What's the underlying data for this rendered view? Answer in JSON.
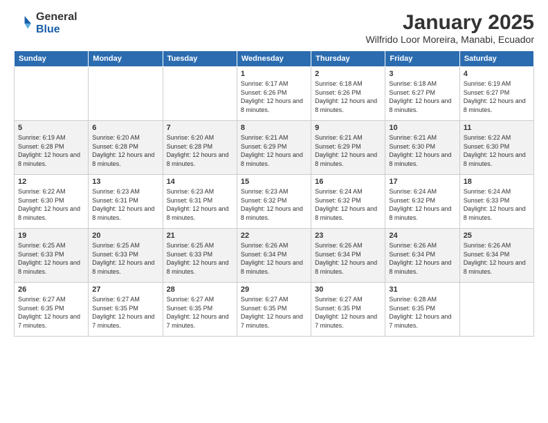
{
  "logo": {
    "general": "General",
    "blue": "Blue"
  },
  "title": "January 2025",
  "subtitle": "Wilfrido Loor Moreira, Manabi, Ecuador",
  "days_of_week": [
    "Sunday",
    "Monday",
    "Tuesday",
    "Wednesday",
    "Thursday",
    "Friday",
    "Saturday"
  ],
  "weeks": [
    [
      {
        "day": "",
        "info": ""
      },
      {
        "day": "",
        "info": ""
      },
      {
        "day": "",
        "info": ""
      },
      {
        "day": "1",
        "info": "Sunrise: 6:17 AM\nSunset: 6:26 PM\nDaylight: 12 hours and 8 minutes."
      },
      {
        "day": "2",
        "info": "Sunrise: 6:18 AM\nSunset: 6:26 PM\nDaylight: 12 hours and 8 minutes."
      },
      {
        "day": "3",
        "info": "Sunrise: 6:18 AM\nSunset: 6:27 PM\nDaylight: 12 hours and 8 minutes."
      },
      {
        "day": "4",
        "info": "Sunrise: 6:19 AM\nSunset: 6:27 PM\nDaylight: 12 hours and 8 minutes."
      }
    ],
    [
      {
        "day": "5",
        "info": "Sunrise: 6:19 AM\nSunset: 6:28 PM\nDaylight: 12 hours and 8 minutes."
      },
      {
        "day": "6",
        "info": "Sunrise: 6:20 AM\nSunset: 6:28 PM\nDaylight: 12 hours and 8 minutes."
      },
      {
        "day": "7",
        "info": "Sunrise: 6:20 AM\nSunset: 6:28 PM\nDaylight: 12 hours and 8 minutes."
      },
      {
        "day": "8",
        "info": "Sunrise: 6:21 AM\nSunset: 6:29 PM\nDaylight: 12 hours and 8 minutes."
      },
      {
        "day": "9",
        "info": "Sunrise: 6:21 AM\nSunset: 6:29 PM\nDaylight: 12 hours and 8 minutes."
      },
      {
        "day": "10",
        "info": "Sunrise: 6:21 AM\nSunset: 6:30 PM\nDaylight: 12 hours and 8 minutes."
      },
      {
        "day": "11",
        "info": "Sunrise: 6:22 AM\nSunset: 6:30 PM\nDaylight: 12 hours and 8 minutes."
      }
    ],
    [
      {
        "day": "12",
        "info": "Sunrise: 6:22 AM\nSunset: 6:30 PM\nDaylight: 12 hours and 8 minutes."
      },
      {
        "day": "13",
        "info": "Sunrise: 6:23 AM\nSunset: 6:31 PM\nDaylight: 12 hours and 8 minutes."
      },
      {
        "day": "14",
        "info": "Sunrise: 6:23 AM\nSunset: 6:31 PM\nDaylight: 12 hours and 8 minutes."
      },
      {
        "day": "15",
        "info": "Sunrise: 6:23 AM\nSunset: 6:32 PM\nDaylight: 12 hours and 8 minutes."
      },
      {
        "day": "16",
        "info": "Sunrise: 6:24 AM\nSunset: 6:32 PM\nDaylight: 12 hours and 8 minutes."
      },
      {
        "day": "17",
        "info": "Sunrise: 6:24 AM\nSunset: 6:32 PM\nDaylight: 12 hours and 8 minutes."
      },
      {
        "day": "18",
        "info": "Sunrise: 6:24 AM\nSunset: 6:33 PM\nDaylight: 12 hours and 8 minutes."
      }
    ],
    [
      {
        "day": "19",
        "info": "Sunrise: 6:25 AM\nSunset: 6:33 PM\nDaylight: 12 hours and 8 minutes."
      },
      {
        "day": "20",
        "info": "Sunrise: 6:25 AM\nSunset: 6:33 PM\nDaylight: 12 hours and 8 minutes."
      },
      {
        "day": "21",
        "info": "Sunrise: 6:25 AM\nSunset: 6:33 PM\nDaylight: 12 hours and 8 minutes."
      },
      {
        "day": "22",
        "info": "Sunrise: 6:26 AM\nSunset: 6:34 PM\nDaylight: 12 hours and 8 minutes."
      },
      {
        "day": "23",
        "info": "Sunrise: 6:26 AM\nSunset: 6:34 PM\nDaylight: 12 hours and 8 minutes."
      },
      {
        "day": "24",
        "info": "Sunrise: 6:26 AM\nSunset: 6:34 PM\nDaylight: 12 hours and 8 minutes."
      },
      {
        "day": "25",
        "info": "Sunrise: 6:26 AM\nSunset: 6:34 PM\nDaylight: 12 hours and 8 minutes."
      }
    ],
    [
      {
        "day": "26",
        "info": "Sunrise: 6:27 AM\nSunset: 6:35 PM\nDaylight: 12 hours and 7 minutes."
      },
      {
        "day": "27",
        "info": "Sunrise: 6:27 AM\nSunset: 6:35 PM\nDaylight: 12 hours and 7 minutes."
      },
      {
        "day": "28",
        "info": "Sunrise: 6:27 AM\nSunset: 6:35 PM\nDaylight: 12 hours and 7 minutes."
      },
      {
        "day": "29",
        "info": "Sunrise: 6:27 AM\nSunset: 6:35 PM\nDaylight: 12 hours and 7 minutes."
      },
      {
        "day": "30",
        "info": "Sunrise: 6:27 AM\nSunset: 6:35 PM\nDaylight: 12 hours and 7 minutes."
      },
      {
        "day": "31",
        "info": "Sunrise: 6:28 AM\nSunset: 6:35 PM\nDaylight: 12 hours and 7 minutes."
      },
      {
        "day": "",
        "info": ""
      }
    ]
  ]
}
